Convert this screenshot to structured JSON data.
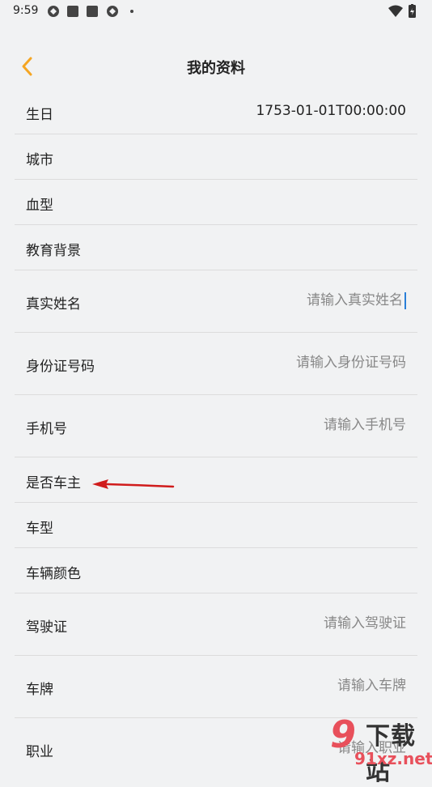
{
  "status_bar": {
    "time": "9:59"
  },
  "header": {
    "title": "我的资料"
  },
  "fields": [
    {
      "label": "生日",
      "value": "1753-01-01T00:00:00"
    },
    {
      "label": "城市",
      "value": ""
    },
    {
      "label": "血型",
      "value": ""
    },
    {
      "label": "教育背景",
      "value": ""
    },
    {
      "label": "真实姓名",
      "placeholder": "请输入真实姓名"
    },
    {
      "label": "身份证号码",
      "placeholder": "请输入身份证号码"
    },
    {
      "label": "手机号",
      "placeholder": "请输入手机号"
    },
    {
      "label": "是否车主",
      "value": ""
    },
    {
      "label": "车型",
      "value": ""
    },
    {
      "label": "车辆颜色",
      "value": ""
    },
    {
      "label": "驾驶证",
      "placeholder": "请输入驾驶证"
    },
    {
      "label": "车牌",
      "placeholder": "请输入车牌"
    },
    {
      "label": "职业",
      "placeholder": "请输入职业"
    }
  ],
  "colors": {
    "accent": "#f5a623",
    "annotation_arrow": "#d01c1c"
  },
  "watermark": {
    "number": "9",
    "text": "下载站",
    "url": "91xz.net"
  }
}
